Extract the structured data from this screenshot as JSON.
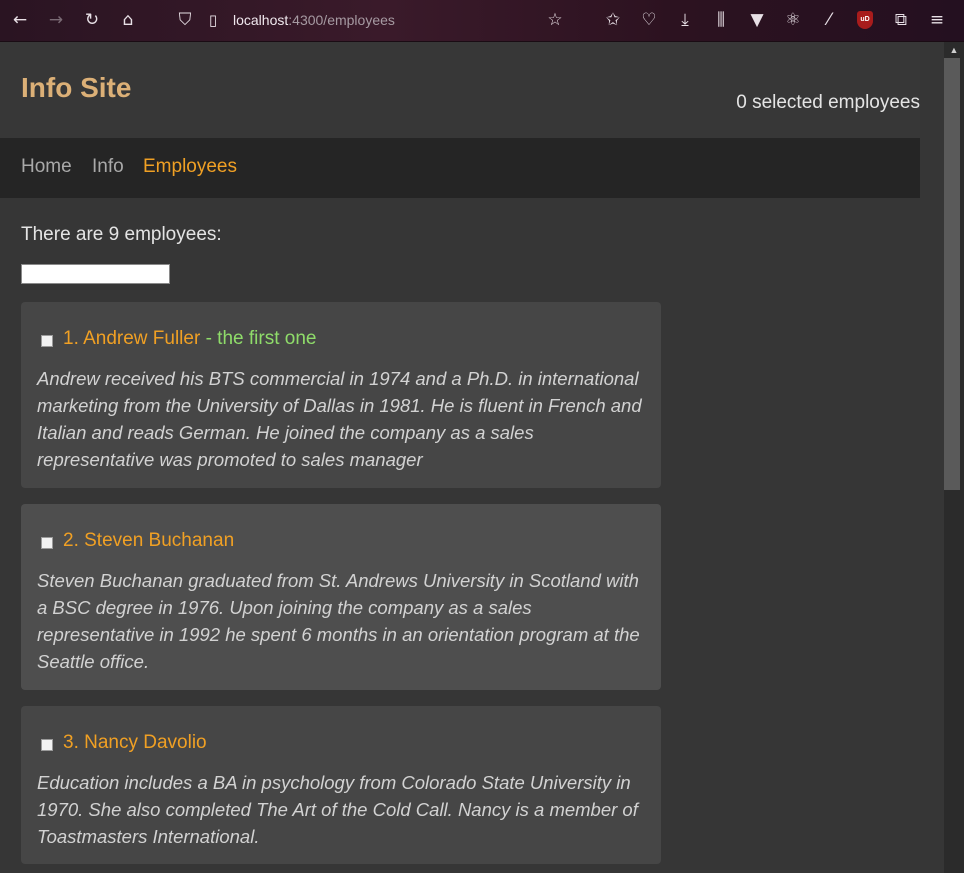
{
  "browser": {
    "url_host": "localhost",
    "url_path": ":4300/employees",
    "ublock_label": "uD"
  },
  "site": {
    "title": "Info Site",
    "selected_count": "0 selected employees"
  },
  "nav": {
    "items": [
      {
        "label": "Home",
        "active": false
      },
      {
        "label": "Info",
        "active": false
      },
      {
        "label": "Employees",
        "active": true
      }
    ]
  },
  "employees_page": {
    "count_text": "There are 9 employees:",
    "filter_value": "",
    "employees": [
      {
        "title": "1. Andrew Fuller",
        "tag": " - the first one",
        "checked": false,
        "description": "Andrew received his BTS commercial in 1974 and a Ph.D. in international marketing from the University of Dallas in 1981. He is fluent in French and Italian and reads German. He joined the company as a sales representative was promoted to sales manager"
      },
      {
        "title": "2. Steven Buchanan",
        "tag": "",
        "checked": false,
        "description": "Steven Buchanan graduated from St. Andrews University in Scotland with a BSC degree in 1976. Upon joining the company as a sales representative in 1992 he spent 6 months in an orientation program at the Seattle office."
      },
      {
        "title": "3. Nancy Davolio",
        "tag": "",
        "checked": false,
        "description": "Education includes a BA in psychology from Colorado State University in 1970. She also completed The Art of the Cold Call. Nancy is a member of Toastmasters International."
      }
    ]
  }
}
